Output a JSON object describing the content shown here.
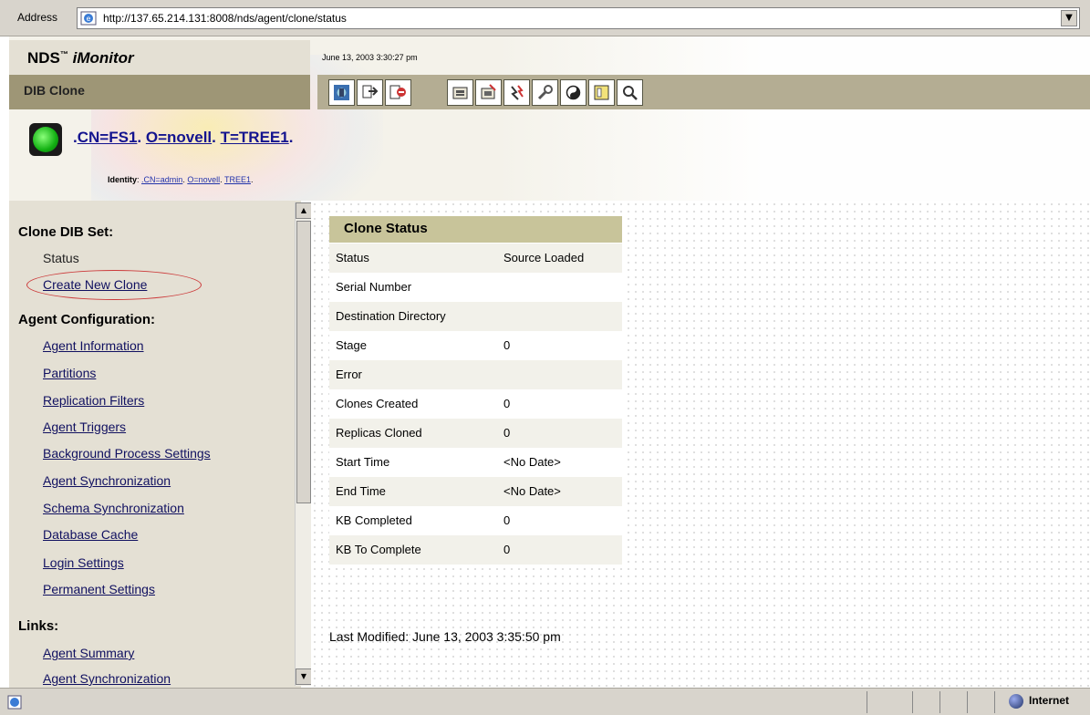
{
  "browser": {
    "address_label": "Address",
    "url": "http://137.65.214.131:8008/nds/agent/clone/status",
    "status_zone": "Internet"
  },
  "header": {
    "product_name": "NDS",
    "product_tm": "™",
    "product_suffix": "iMonitor",
    "timestamp": "June 13, 2003 3:30:27 pm",
    "page_title": "DIB Clone",
    "server_dn": {
      "prefix": ".",
      "cn": "CN=FS1",
      "sep1": ". ",
      "o": "O=novell",
      "sep2": ". ",
      "t": "T=TREE1",
      "suffix": "."
    },
    "identity": {
      "label": "Identity",
      "cn": ".CN=admin",
      "o": "O=novell",
      "t": "TREE1"
    }
  },
  "toolbar": {
    "buttons": [
      "home-icon",
      "navigate-icon",
      "exit-icon",
      "server-info-icon",
      "repair-icon",
      "trace-icon",
      "configure-icon",
      "yin-yang-icon",
      "report-icon",
      "search-icon"
    ]
  },
  "nav": {
    "section_clone": "Clone DIB Set:",
    "clone_items": [
      "Status",
      "Create New Clone"
    ],
    "section_agent": "Agent Configuration:",
    "agent_items": [
      "Agent Information",
      "Partitions",
      "Replication Filters",
      "Agent Triggers",
      "Background Process Settings",
      "Agent Synchronization",
      "Schema Synchronization",
      "Database Cache",
      "Login Settings",
      "Permanent Settings"
    ],
    "section_links": "Links:",
    "link_items": [
      "Agent Summary",
      "Agent Synchronization"
    ]
  },
  "clone_status": {
    "title": "Clone Status",
    "rows": [
      {
        "label": "Status",
        "value": "Source Loaded"
      },
      {
        "label": "Serial Number",
        "value": ""
      },
      {
        "label": "Destination Directory",
        "value": ""
      },
      {
        "label": "Stage",
        "value": "0"
      },
      {
        "label": "Error",
        "value": ""
      },
      {
        "label": "Clones Created",
        "value": "0"
      },
      {
        "label": "Replicas Cloned",
        "value": "0"
      },
      {
        "label": "Start Time",
        "value": "<No Date>"
      },
      {
        "label": "End Time",
        "value": "<No Date>"
      },
      {
        "label": "KB Completed",
        "value": "0"
      },
      {
        "label": "KB To Complete",
        "value": "0"
      }
    ]
  },
  "last_modified": "Last Modified: June 13, 2003 3:35:50 pm",
  "colors": {
    "link": "#101060",
    "banner_strip": "#9e9676",
    "table_header": "#c8c49a",
    "highlight_ring": "#cc3b3b"
  }
}
